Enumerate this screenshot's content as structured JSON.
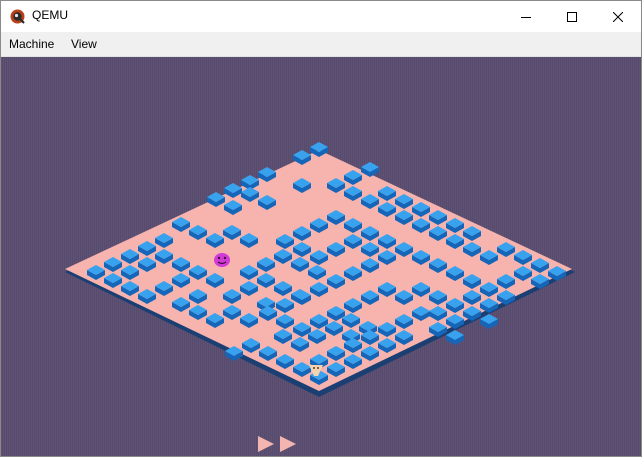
{
  "window": {
    "title": "QEMU",
    "app_icon": "qemu-icon",
    "controls": [
      "minimize-icon",
      "maximize-icon",
      "close-icon"
    ]
  },
  "menubar": {
    "items": [
      {
        "label": "Machine"
      },
      {
        "label": "View"
      }
    ]
  },
  "game": {
    "colors": {
      "background": "#5b4f72",
      "floor": "#f7b3ad",
      "floor_edge": "#1c3f73",
      "block_top": "#39a2ee",
      "block_side": "#1565b8",
      "player": "#d23ad6",
      "enemy": "#f6d3b0",
      "lives_marker": "#f3b5b0"
    },
    "lives_remaining": 2,
    "icons": [
      "smiley-player-icon",
      "shell-enemy-icon",
      "life-arrow-icon"
    ]
  }
}
